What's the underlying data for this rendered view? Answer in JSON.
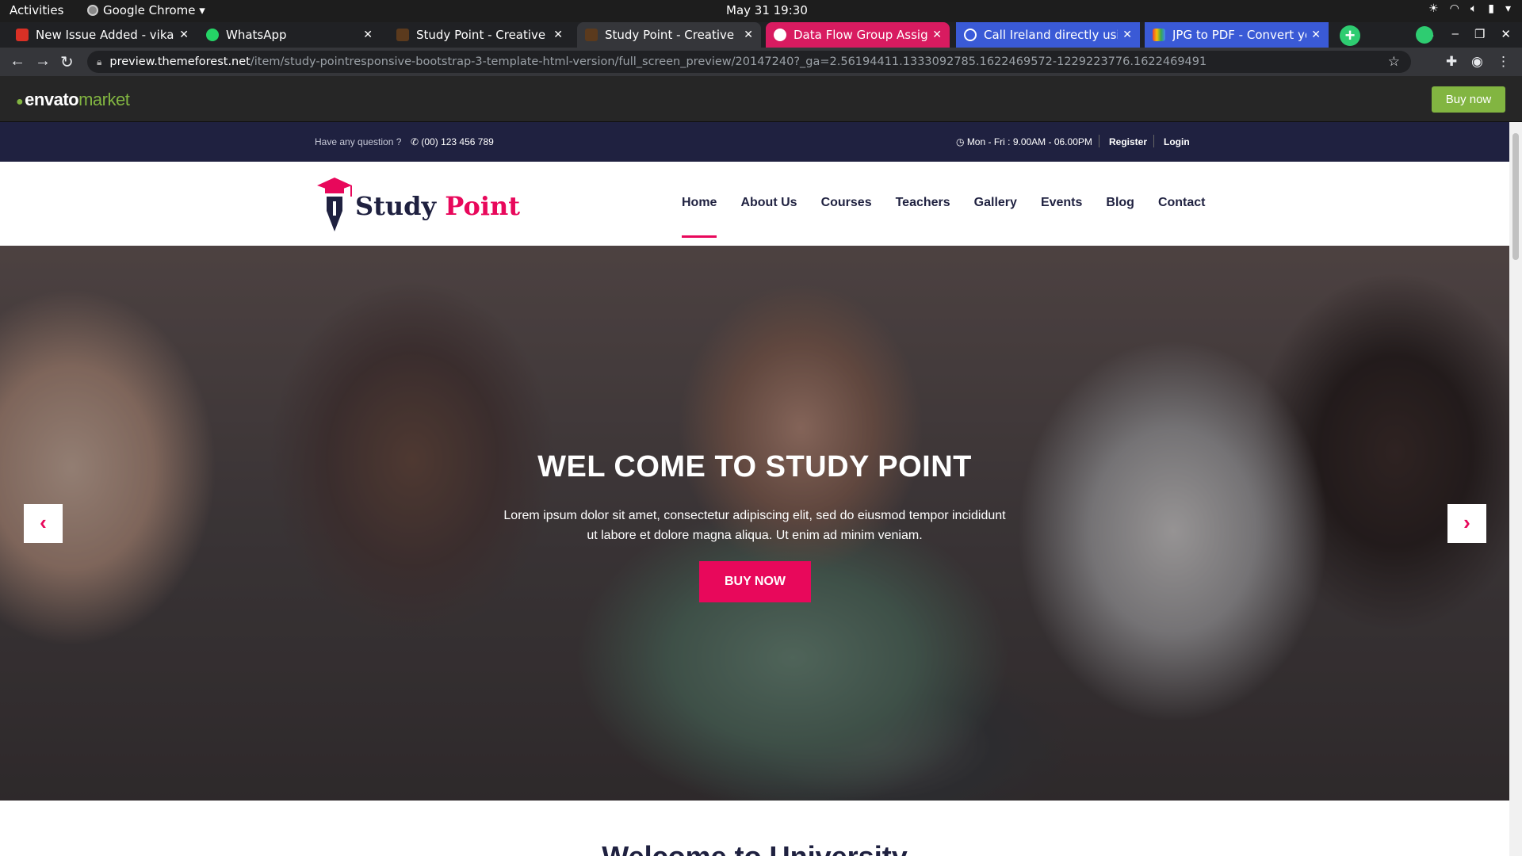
{
  "topbar": {
    "activities": "Activities",
    "app": "Google Chrome ▾",
    "clock": "May 31  19:30"
  },
  "tabs": [
    {
      "title": "New Issue Added - vikash",
      "color": "#d93025"
    },
    {
      "title": "WhatsApp",
      "color": "#25d366"
    },
    {
      "title": "Study Point - Creative Mul",
      "color": "#5b3a1d"
    },
    {
      "title": "Study Point - Creative Mul",
      "color": "#5b3a1d"
    },
    {
      "title": "Data Flow Group Assignm",
      "color": "#ffffff"
    },
    {
      "title": "Call Ireland directly using",
      "color": "#3b5bdb"
    },
    {
      "title": "JPG to PDF - Convert your",
      "color": "#f4b400"
    }
  ],
  "address": {
    "host": "preview.themeforest.net",
    "path": "/item/study-pointresponsive-bootstrap-3-template-html-version/full_screen_preview/20147240?_ga=2.56194411.1333092785.1622469572-1229223776.1622469491"
  },
  "envato": {
    "logo_main": "envato",
    "logo_market": "market",
    "buy_label": "Buy now"
  },
  "infobar": {
    "question": "Have any question ?",
    "phone": "(00) 123 456 789",
    "hours": "Mon - Fri : 9.00AM - 06.00PM",
    "register": "Register",
    "login": "Login"
  },
  "brand": {
    "word1": "Study",
    "word2": "Point"
  },
  "menu": [
    "Home",
    "About Us",
    "Courses",
    "Teachers",
    "Gallery",
    "Events",
    "Blog",
    "Contact"
  ],
  "hero": {
    "title": "WEL COME TO STUDY POINT",
    "text": "Lorem ipsum dolor sit amet, consectetur adipiscing elit, sed do eiusmod tempor incididunt ut labore et dolore magna aliqua. Ut enim ad minim veniam.",
    "cta": "BUY NOW",
    "prev": "‹",
    "next": "›"
  },
  "next_heading": "Welcome to University",
  "colors": {
    "accent": "#e8085b",
    "navy": "#1f2140",
    "envato_green": "#82b541"
  }
}
